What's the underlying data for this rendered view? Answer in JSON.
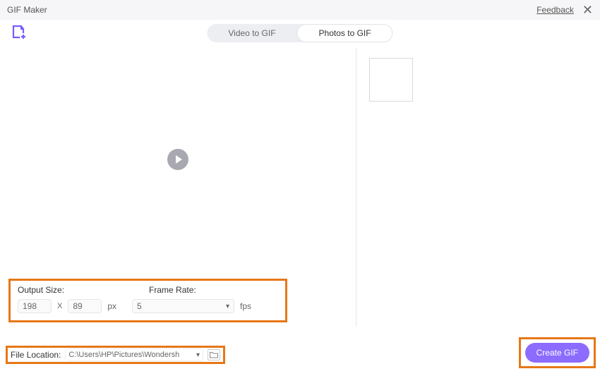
{
  "header": {
    "title": "GIF Maker",
    "feedback_label": "Feedback"
  },
  "tabs": {
    "video_to_gif": "Video to GIF",
    "photos_to_gif": "Photos to GIF",
    "active": "photos_to_gif"
  },
  "settings": {
    "output_size_label": "Output Size:",
    "width_value": "198",
    "height_value": "89",
    "multiply_symbol": "X",
    "px_unit": "px",
    "frame_rate_label": "Frame Rate:",
    "frame_rate_value": "5",
    "fps_unit": "fps"
  },
  "file_location": {
    "label": "File Location:",
    "path": "C:\\Users\\HP\\Pictures\\Wondersh"
  },
  "actions": {
    "create_label": "Create GIF"
  },
  "colors": {
    "accent": "#8b6cff",
    "highlight_border": "#e67817"
  }
}
